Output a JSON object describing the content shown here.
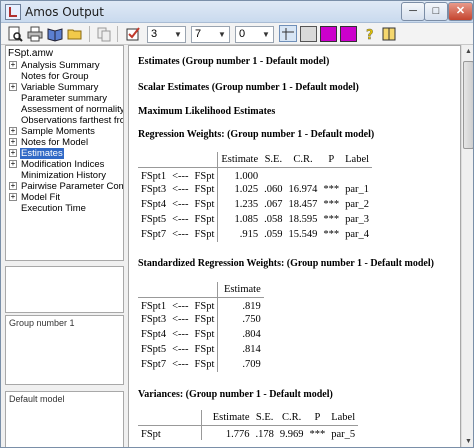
{
  "window": {
    "title": "Amos Output"
  },
  "window_buttons": {
    "minimize": "─",
    "maximize": "□",
    "close": "✕"
  },
  "toolbar": {
    "decimals": "3",
    "columns": "7",
    "rows": "0",
    "icons": [
      "print-preview-icon",
      "print-icon",
      "open-book-icon",
      "open-folder-icon",
      "copy-icon",
      "checkbox-options-icon",
      "table-view-icon",
      "text-view-icon",
      "magenta-box-icon",
      "magenta-box-icon",
      "help-icon",
      "book-icon"
    ],
    "colors": {
      "magenta": "#cc00cc",
      "accent": "#3169c6"
    }
  },
  "tree": {
    "root": "FSpt.amw",
    "items": [
      {
        "label": "Analysis Summary",
        "expander": "+"
      },
      {
        "label": "Notes for Group",
        "expander": ""
      },
      {
        "label": "Variable Summary",
        "expander": "+"
      },
      {
        "label": "Parameter summary",
        "expander": ""
      },
      {
        "label": "Assessment of normality",
        "expander": ""
      },
      {
        "label": "Observations farthest from",
        "expander": ""
      },
      {
        "label": "Sample Moments",
        "expander": "+"
      },
      {
        "label": "Notes for Model",
        "expander": "+"
      },
      {
        "label": "Estimates",
        "expander": "+",
        "selected": true
      },
      {
        "label": "Modification Indices",
        "expander": "+"
      },
      {
        "label": "Minimization History",
        "expander": ""
      },
      {
        "label": "Pairwise Parameter Compar",
        "expander": "+"
      },
      {
        "label": "Model Fit",
        "expander": "+"
      },
      {
        "label": "Execution Time",
        "expander": ""
      }
    ]
  },
  "panels": {
    "group": "Group number 1",
    "model": "Default model"
  },
  "main": {
    "heading1": "Estimates (Group number 1 - Default model)",
    "heading2": "Scalar Estimates (Group number 1 - Default model)",
    "heading3": "Maximum Likelihood Estimates",
    "regression": {
      "title": "Regression Weights: (Group number 1 - Default model)",
      "columns": [
        "Estimate",
        "S.E.",
        "C.R.",
        "P",
        "Label"
      ],
      "rows": [
        {
          "y": "FSpt1",
          "arrow": "<---",
          "x": "FSpt",
          "est": "1.000",
          "se": "",
          "cr": "",
          "p": "",
          "label": ""
        },
        {
          "y": "FSpt3",
          "arrow": "<---",
          "x": "FSpt",
          "est": "1.025",
          "se": ".060",
          "cr": "16.974",
          "p": "***",
          "label": "par_1"
        },
        {
          "y": "FSpt4",
          "arrow": "<---",
          "x": "FSpt",
          "est": "1.235",
          "se": ".067",
          "cr": "18.457",
          "p": "***",
          "label": "par_2"
        },
        {
          "y": "FSpt5",
          "arrow": "<---",
          "x": "FSpt",
          "est": "1.085",
          "se": ".058",
          "cr": "18.595",
          "p": "***",
          "label": "par_3"
        },
        {
          "y": "FSpt7",
          "arrow": "<---",
          "x": "FSpt",
          "est": ".915",
          "se": ".059",
          "cr": "15.549",
          "p": "***",
          "label": "par_4"
        }
      ]
    },
    "standardized": {
      "title": "Standardized Regression Weights: (Group number 1 - Default model)",
      "columns": [
        "Estimate"
      ],
      "rows": [
        {
          "y": "FSpt1",
          "arrow": "<---",
          "x": "FSpt",
          "est": ".819"
        },
        {
          "y": "FSpt3",
          "arrow": "<---",
          "x": "FSpt",
          "est": ".750"
        },
        {
          "y": "FSpt4",
          "arrow": "<---",
          "x": "FSpt",
          "est": ".804"
        },
        {
          "y": "FSpt5",
          "arrow": "<---",
          "x": "FSpt",
          "est": ".814"
        },
        {
          "y": "FSpt7",
          "arrow": "<---",
          "x": "FSpt",
          "est": ".709"
        }
      ]
    },
    "variances": {
      "title": "Variances: (Group number 1 - Default model)",
      "columns": [
        "Estimate",
        "S.E.",
        "C.R.",
        "P",
        "Label"
      ],
      "rows": [
        {
          "y": "FSpt",
          "est": "1.776",
          "se": ".178",
          "cr": "9.969",
          "p": "***",
          "label": "par_5"
        }
      ]
    }
  }
}
